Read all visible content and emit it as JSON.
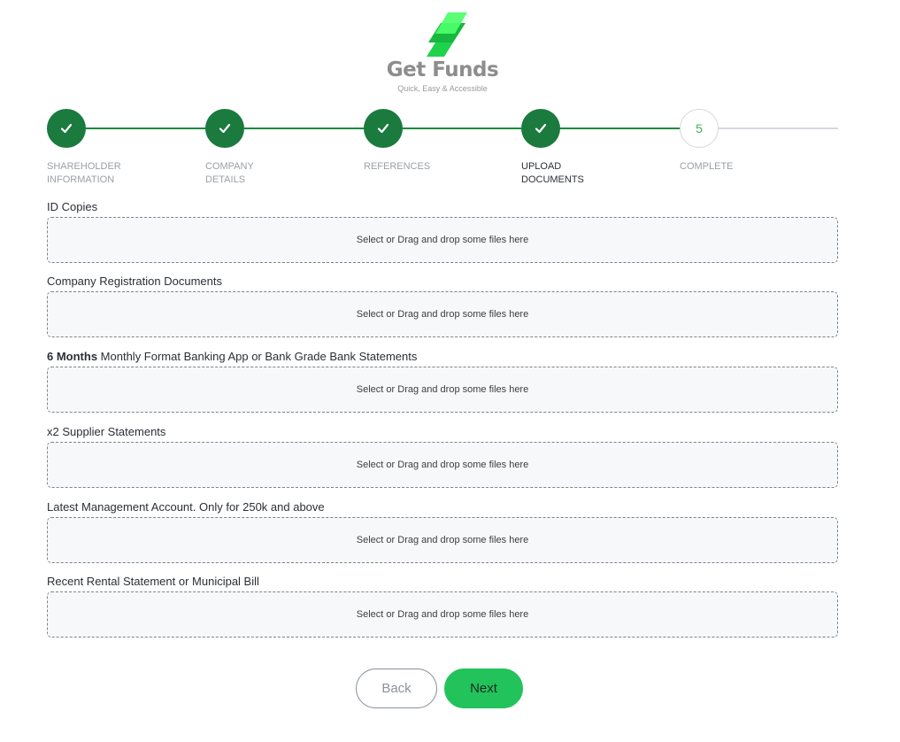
{
  "brand": {
    "name": "Get Funds",
    "tagline": "Quick, Easy & Accessible",
    "logo_icon": "lightning-layers-logo"
  },
  "stepper": {
    "steps": [
      {
        "label": "SHAREHOLDER\nINFORMATION",
        "status": "completed",
        "icon": "check-icon"
      },
      {
        "label": "COMPANY\nDETAILS",
        "status": "completed",
        "icon": "check-icon"
      },
      {
        "label": "REFERENCES",
        "status": "completed",
        "icon": "check-icon"
      },
      {
        "label": "UPLOAD\nDOCUMENTS",
        "status": "current",
        "icon": "check-icon"
      },
      {
        "label": "COMPLETE",
        "status": "pending",
        "number": "5"
      }
    ]
  },
  "uploads": [
    {
      "label": "ID Copies",
      "placeholder": "Select or Drag and drop some files here"
    },
    {
      "label": "Company Registration Documents",
      "placeholder": "Select or Drag and drop some files here"
    },
    {
      "label_bold": "6 Months",
      "label": " Monthly Format Banking App or Bank Grade Bank Statements",
      "placeholder": "Select or Drag and drop some files here"
    },
    {
      "label": "x2 Supplier Statements",
      "placeholder": "Select or Drag and drop some files here"
    },
    {
      "label": "Latest Management Account. Only for 250k and above",
      "placeholder": "Select or Drag and drop some files here"
    },
    {
      "label": "Recent Rental Statement or Municipal Bill",
      "placeholder": "Select or Drag and drop some files here"
    }
  ],
  "actions": {
    "back_label": "Back",
    "next_label": "Next"
  },
  "colors": {
    "step_complete": "#1b7a3e",
    "progress_line": "#1a8c3e",
    "next_button": "#22c35a",
    "logo_green_light": "#4cff6a",
    "logo_green_dark": "#16b83f"
  }
}
